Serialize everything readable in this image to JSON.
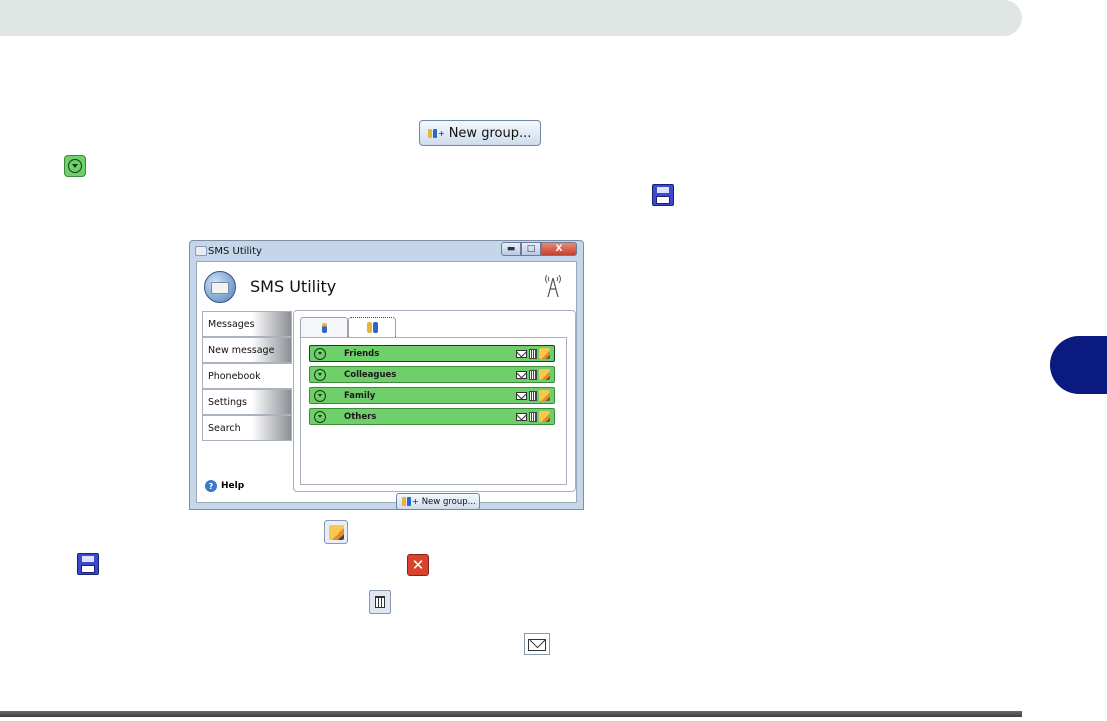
{
  "doc": {
    "inline_new_group_label": "New group..."
  },
  "window": {
    "title": "SMS Utility",
    "controls": {
      "minimize": "▬",
      "maximize": "□",
      "close": "X"
    }
  },
  "app": {
    "header_title": "SMS Utility",
    "nav": [
      {
        "label": "Messages"
      },
      {
        "label": "New message"
      },
      {
        "label": "Phonebook"
      },
      {
        "label": "Settings"
      },
      {
        "label": "Search"
      }
    ],
    "active_nav": "Phonebook",
    "help_label": "Help",
    "help_icon": "?",
    "tabs": [
      {
        "icon": "contact-icon"
      },
      {
        "icon": "group-icon"
      }
    ],
    "groups": [
      {
        "name": "Friends"
      },
      {
        "name": "Colleagues"
      },
      {
        "name": "Family"
      },
      {
        "name": "Others"
      }
    ],
    "new_group_label": "New group..."
  },
  "colors": {
    "group_row": "#6fcf6a",
    "header_bar": "#dfe6e3",
    "side_tab": "#0b1a80",
    "save_icon": "#3b4bd0",
    "delete_icon": "#d9432c"
  }
}
